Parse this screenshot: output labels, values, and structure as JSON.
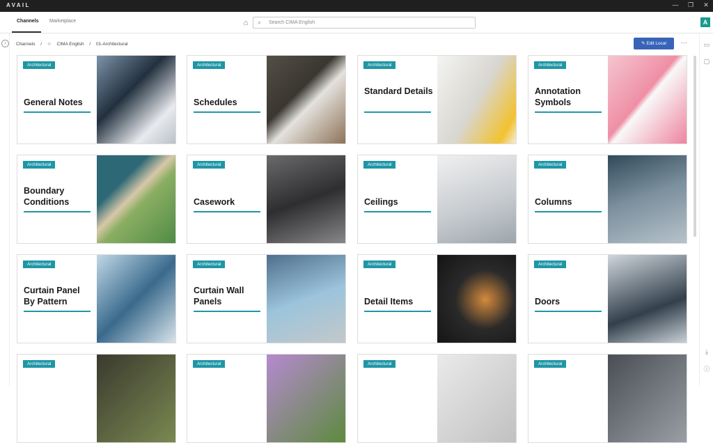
{
  "app": {
    "brand": "AVAIL",
    "avatar_letter": "A"
  },
  "window": {
    "minimize": "—",
    "restore": "❐",
    "close": "✕"
  },
  "nav": {
    "tabs": [
      {
        "label": "Channels",
        "active": true
      },
      {
        "label": "Marketplace",
        "active": false
      }
    ]
  },
  "search": {
    "placeholder": "Search CIMA English"
  },
  "breadcrumb": {
    "items": [
      "Channels",
      "CIMA English",
      "01-Architectural"
    ],
    "separator": "/",
    "star": "☆"
  },
  "toolbar": {
    "edit_label": "Edit Local",
    "more": "···"
  },
  "colors": {
    "accent": "#1e96a6",
    "button": "#3864b8",
    "avatar": "#1a9a8e"
  },
  "cards": [
    {
      "badge": "Architectural",
      "title": "General Notes",
      "image": "business-signing"
    },
    {
      "badge": "Architectural",
      "title": "Schedules",
      "image": "tablet-calendar"
    },
    {
      "badge": "Architectural",
      "title": "Standard Details",
      "image": "drafting-tools"
    },
    {
      "badge": "Architectural",
      "title": "Annotation Symbols",
      "image": "speech-bubble"
    },
    {
      "badge": "Architectural",
      "title": "Boundary Conditions",
      "image": "tennis-court"
    },
    {
      "badge": "Architectural",
      "title": "Casework",
      "image": "kitchen-cabinets"
    },
    {
      "badge": "Architectural",
      "title": "Ceilings",
      "image": "ceiling-lights"
    },
    {
      "badge": "Architectural",
      "title": "Columns",
      "image": "building-columns"
    },
    {
      "badge": "Architectural",
      "title": "Curtain Panel By Pattern",
      "image": "glass-facade"
    },
    {
      "badge": "Architectural",
      "title": "Curtain Wall Panels",
      "image": "glass-wall"
    },
    {
      "badge": "Architectural",
      "title": "Detail Items",
      "image": "circuit-board"
    },
    {
      "badge": "Architectural",
      "title": "Doors",
      "image": "glass-doors"
    },
    {
      "badge": "Architectural",
      "title": "",
      "image": "electrical-panel"
    },
    {
      "badge": "Architectural",
      "title": "",
      "image": "flowers"
    },
    {
      "badge": "Architectural",
      "title": "",
      "image": "wall-frames"
    },
    {
      "badge": "Architectural",
      "title": "",
      "image": "street-lamp"
    }
  ]
}
